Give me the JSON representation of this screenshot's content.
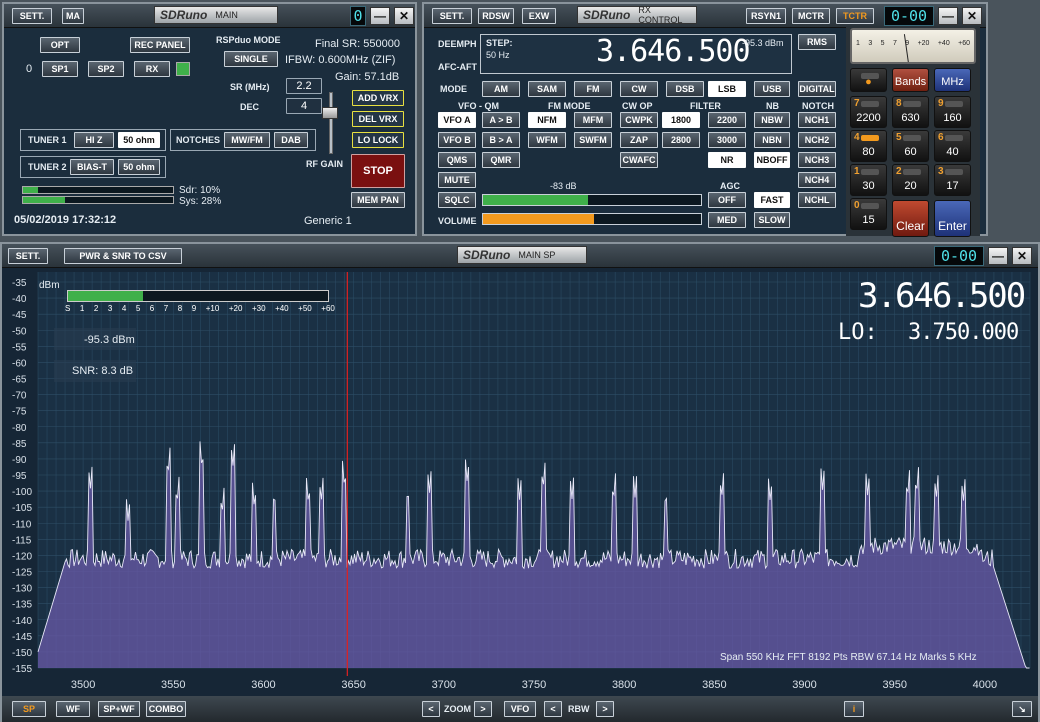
{
  "main": {
    "sett": "SETT.",
    "ma": "MA",
    "logo": "SDRuno",
    "title": "MAIN",
    "seg": "0",
    "opt": "OPT",
    "rec_panel": "REC PANEL",
    "zero": "0",
    "sp1": "SP1",
    "sp2": "SP2",
    "rx": "RX",
    "rspduo_mode": "RSPduo MODE",
    "single": "SINGLE",
    "final_sr": "Final SR: 550000",
    "ifbw": "IFBW: 0.600MHz (ZIF)",
    "gain": "Gain: 57.1dB",
    "sr_label": "SR (MHz)",
    "sr_value": "2.2",
    "dec_label": "DEC",
    "dec_value": "4",
    "add_vrx": "ADD VRX",
    "del_vrx": "DEL VRX",
    "lo_lock": "LO LOCK",
    "stop": "STOP",
    "mem_pan": "MEM PAN",
    "rf_gain": "RF GAIN",
    "tuner1": "TUNER 1",
    "hiz": "HI Z",
    "ohm1": "50 ohm",
    "notches": "NOTCHES",
    "mwfm": "MW/FM",
    "dab": "DAB",
    "tuner2": "TUNER 2",
    "biast": "BIAS-T",
    "ohm2": "50 ohm",
    "sdr": "Sdr: 10%",
    "sys": "Sys: 28%",
    "sdr_level": 0.1,
    "sys_level": 0.28,
    "datetime": "05/02/2019 17:32:12",
    "generic": "Generic 1"
  },
  "rx": {
    "sett": "SETT.",
    "rdsw": "RDSW",
    "exw": "EXW",
    "logo": "SDRuno",
    "title": "RX CONTROL",
    "rsyn1": "RSYN1",
    "mctr": "MCTR",
    "tctr": "TCTR",
    "seg": "0-00",
    "deemph": "DEEMPH",
    "afc_aft": "AFC-AFT",
    "step_label": "STEP:",
    "step_value": "50 Hz",
    "freq": "3.646.500",
    "dbm": "-95.3 dBm",
    "rms": "RMS",
    "mode_label": "MODE",
    "modes": [
      "AM",
      "SAM",
      "FM",
      "CW",
      "DSB",
      "LSB",
      "USB",
      "DIGITAL"
    ],
    "vfo_qm": "VFO - QM",
    "fm_mode": "FM MODE",
    "cw_op": "CW OP",
    "filter": "FILTER",
    "nb": "NB",
    "notch": "NOTCH",
    "vfoa": "VFO A",
    "atob": "A > B",
    "nfm": "NFM",
    "mfm": "MFM",
    "cwpk": "CWPK",
    "f1800": "1800",
    "f2200": "2200",
    "nbw": "NBW",
    "nch1": "NCH1",
    "vfob": "VFO B",
    "btoa": "B > A",
    "wfm": "WFM",
    "swfm": "SWFM",
    "zap": "ZAP",
    "f2800": "2800",
    "f3000": "3000",
    "nbn": "NBN",
    "nch2": "NCH2",
    "qms": "QMS",
    "qmr": "QMR",
    "cwafc": "CWAFC",
    "nr": "NR",
    "nboff": "NBOFF",
    "nch3": "NCH3",
    "mute": "MUTE",
    "sq_db": "-83 dB",
    "agc": "AGC",
    "nch4": "NCH4",
    "sqlc": "SQLC",
    "off": "OFF",
    "fast": "FAST",
    "nchl": "NCHL",
    "sqlc_level": 0.48,
    "volume": "VOLUME",
    "med": "MED",
    "slow": "SLOW",
    "volume_level": 0.51
  },
  "keypad": {
    "meter_ticks": [
      "1",
      "3",
      "5",
      "7",
      "9",
      "+20",
      "+40",
      "+60"
    ],
    "bands": "Bands",
    "mhz": "MHz",
    "clear": "Clear",
    "enter": "Enter",
    "keys": [
      {
        "d": "7",
        "v": "2200"
      },
      {
        "d": "8",
        "v": "630"
      },
      {
        "d": "9",
        "v": "160"
      },
      {
        "d": "4",
        "v": "80"
      },
      {
        "d": "5",
        "v": "60"
      },
      {
        "d": "6",
        "v": "40"
      },
      {
        "d": "1",
        "v": "30"
      },
      {
        "d": "2",
        "v": "20"
      },
      {
        "d": "3",
        "v": "17"
      },
      {
        "d": "0",
        "v": "15"
      }
    ]
  },
  "sp": {
    "sett": "SETT.",
    "csv": "PWR & SNR TO CSV",
    "logo": "SDRuno",
    "title": "MAIN SP",
    "seg": "0-00",
    "dbm_unit": "dBm",
    "smeter_labels": [
      "S",
      "1",
      "2",
      "3",
      "4",
      "5",
      "6",
      "7",
      "8",
      "9",
      "+10",
      "+20",
      "+30",
      "+40",
      "+50",
      "+60"
    ],
    "smeter_level": 0.29,
    "level": "-95.3 dBm",
    "snr": "SNR: 8.3 dB",
    "freq": "3.646.500",
    "lo_label": "LO:",
    "lo_value": "3.750.000",
    "status": "Span 550 KHz   FFT 8192 Pts   RBW 67.14 Hz   Marks 5 KHz",
    "sp_btn": "SP",
    "wf": "WF",
    "spwf": "SP+WF",
    "combo": "COMBO",
    "zoom": "ZOOM",
    "vfo": "VFO",
    "rbw": "RBW",
    "info": "i"
  },
  "colors": {
    "accent": "#f39a1e",
    "green": "#3fb04a",
    "stop": "#7a1010",
    "marker": "#e02020",
    "fill": "#6a5aa8"
  },
  "chart_data": {
    "type": "area",
    "title": "",
    "xlabel": "",
    "ylabel": "dBm",
    "xlim": [
      3500,
      4000
    ],
    "ylim": [
      -155,
      -35
    ],
    "x_ticks": [
      3500,
      3550,
      3600,
      3650,
      3700,
      3750,
      3800,
      3850,
      3900,
      3950,
      4000
    ],
    "y_ticks": [
      -35,
      -40,
      -45,
      -50,
      -55,
      -60,
      -65,
      -70,
      -75,
      -80,
      -85,
      -90,
      -95,
      -100,
      -105,
      -110,
      -115,
      -120,
      -125,
      -130,
      -135,
      -140,
      -145,
      -150,
      -155
    ],
    "x_range": [
      3475,
      4025
    ],
    "noise_floor": -120,
    "vfo_marker": 3646.5,
    "peaks": [
      {
        "x": 3504,
        "y": -100
      },
      {
        "x": 3525,
        "y": -110
      },
      {
        "x": 3547,
        "y": -96
      },
      {
        "x": 3552,
        "y": -105
      },
      {
        "x": 3566,
        "y": -94
      },
      {
        "x": 3577,
        "y": -108
      },
      {
        "x": 3583,
        "y": -93
      },
      {
        "x": 3595,
        "y": -106
      },
      {
        "x": 3606,
        "y": -106
      },
      {
        "x": 3625,
        "y": -105
      },
      {
        "x": 3632,
        "y": -104
      },
      {
        "x": 3645,
        "y": -100
      },
      {
        "x": 3680,
        "y": -105
      },
      {
        "x": 3692,
        "y": -101
      },
      {
        "x": 3713,
        "y": -98
      },
      {
        "x": 3742,
        "y": -103
      },
      {
        "x": 3755,
        "y": -100
      },
      {
        "x": 3771,
        "y": -103
      },
      {
        "x": 3794,
        "y": -104
      },
      {
        "x": 3806,
        "y": -102
      },
      {
        "x": 3823,
        "y": -106
      },
      {
        "x": 3854,
        "y": -103
      },
      {
        "x": 3881,
        "y": -104
      },
      {
        "x": 3910,
        "y": -100
      },
      {
        "x": 3935,
        "y": -102
      },
      {
        "x": 3957,
        "y": -103
      },
      {
        "x": 3962,
        "y": -102
      },
      {
        "x": 3973,
        "y": -103
      },
      {
        "x": 3988,
        "y": -104
      }
    ]
  }
}
